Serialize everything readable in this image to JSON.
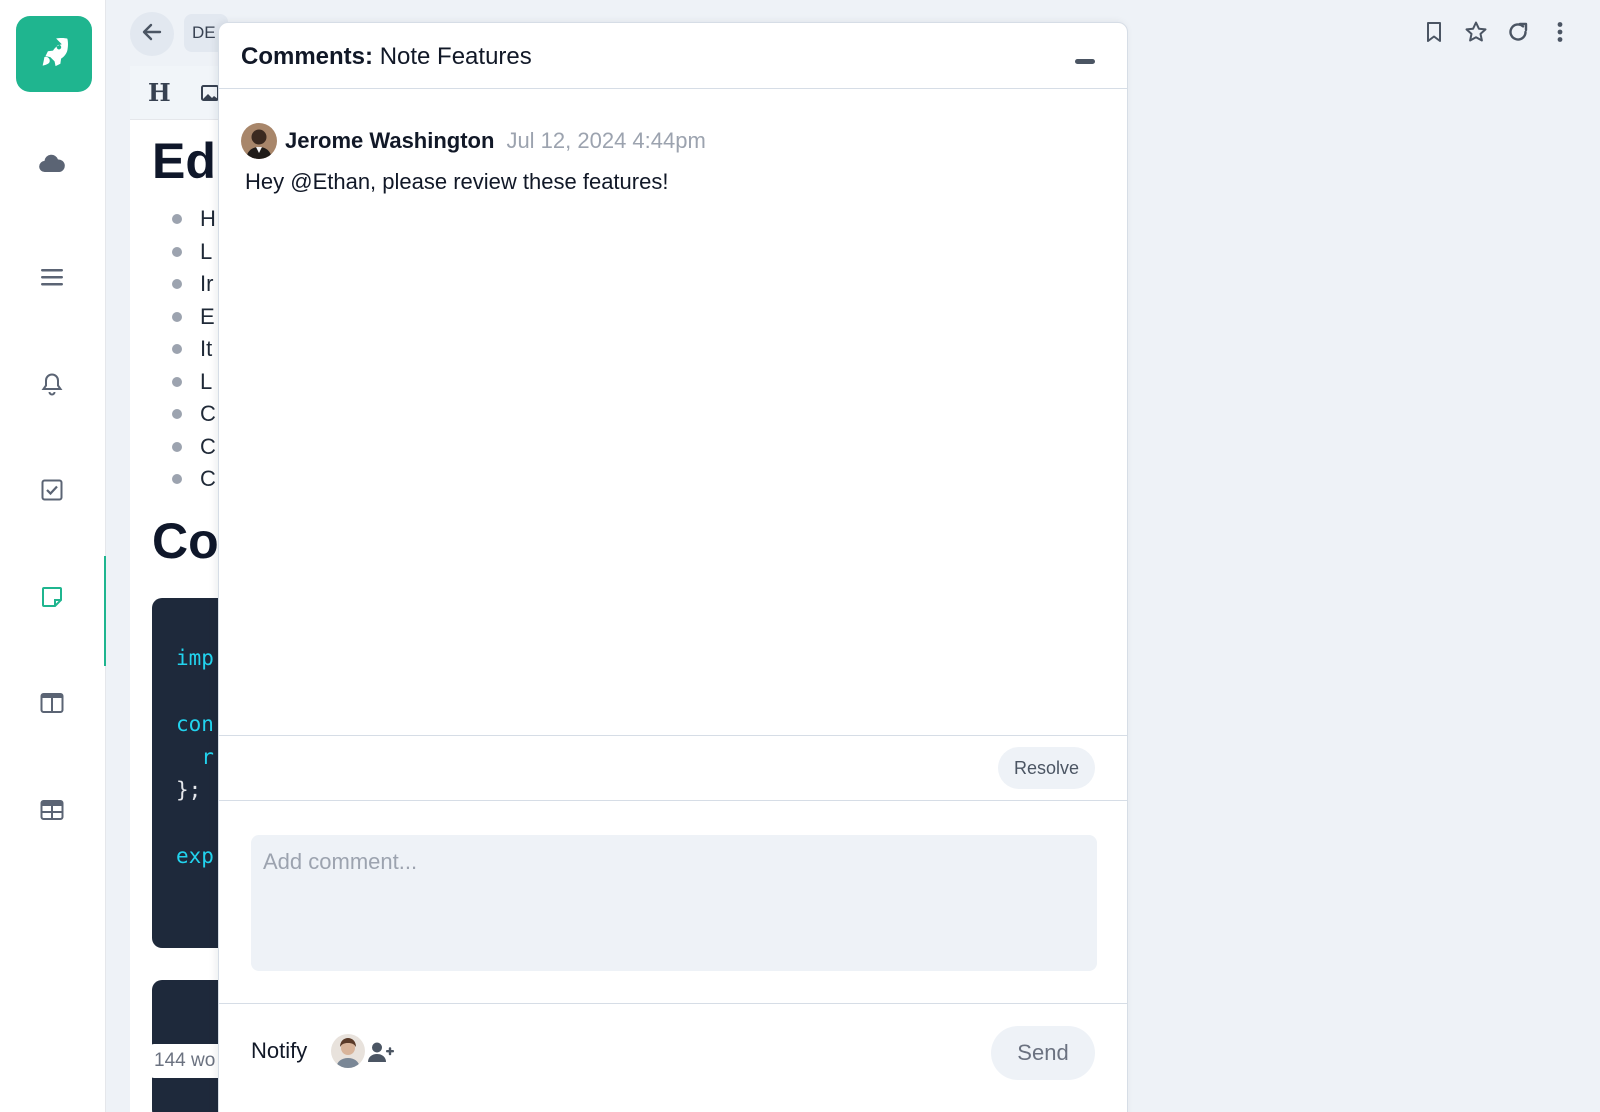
{
  "nav": {
    "logo_icon": "rocket-icon",
    "items": [
      {
        "name": "cloud",
        "icon": "cloud-icon"
      },
      {
        "name": "list",
        "icon": "menu-icon"
      },
      {
        "name": "notifications",
        "icon": "bell-icon"
      },
      {
        "name": "tasks",
        "icon": "checkbox-icon"
      },
      {
        "name": "notes",
        "icon": "note-icon",
        "active": true
      },
      {
        "name": "layout",
        "icon": "columns-icon"
      },
      {
        "name": "tables",
        "icon": "table-icon"
      }
    ],
    "accent_color": "#1fb58f"
  },
  "topbar": {
    "breadcrumb": "DE",
    "actions": [
      "bookmark-icon",
      "star-icon",
      "refresh-icon",
      "more-vertical-icon"
    ]
  },
  "editor": {
    "toolbar": {
      "heading_glyph": "H"
    },
    "heading1": "Edi",
    "bullets": [
      "H",
      "L",
      "Ir",
      "E",
      "It",
      "L",
      "C",
      "C",
      "C"
    ],
    "heading2": "Co",
    "code_lines": [
      {
        "text": "imp",
        "keyword": true
      },
      {
        "text": "con",
        "keyword": true
      },
      {
        "text": "  r",
        "keyword": true
      },
      {
        "text": "};",
        "keyword": false
      },
      {
        "text": "exp",
        "keyword": true
      }
    ],
    "word_count": "144 wo"
  },
  "comments_panel": {
    "title_prefix": "Comments:",
    "title": "Note Features",
    "comment": {
      "author": "Jerome Washington",
      "timestamp": "Jul 12, 2024 4:44pm",
      "text": "Hey @Ethan, please review these features!"
    },
    "resolve_label": "Resolve",
    "input_placeholder": "Add comment...",
    "notify_label": "Notify",
    "send_label": "Send"
  }
}
